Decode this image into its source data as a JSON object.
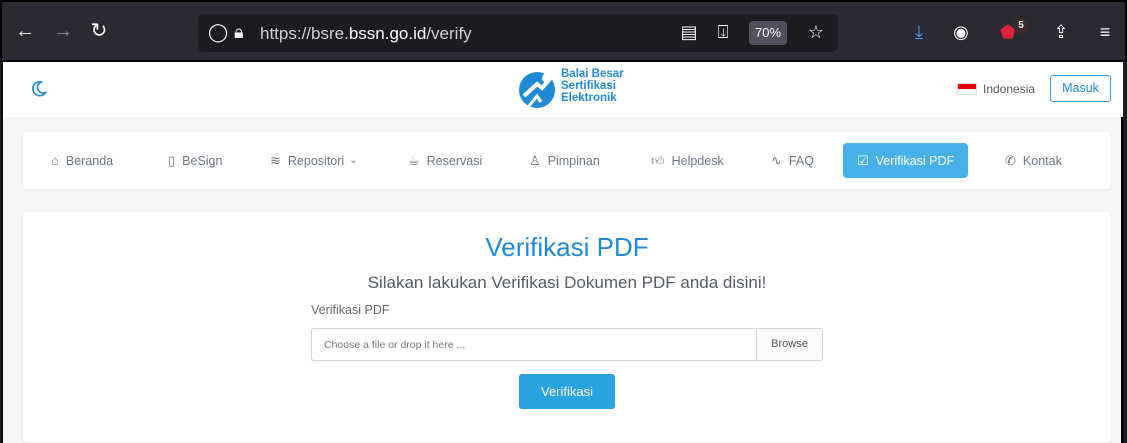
{
  "browser": {
    "url_prefix": "https://bsre.",
    "url_domain": "bssn.go.id",
    "url_path": "/verify",
    "zoom": "70%",
    "extension_badge": "5"
  },
  "header": {
    "logo_line1": "Balai Besar",
    "logo_line2": "Sertifikasi",
    "logo_line3": "Elektronik",
    "language": "Indonesia",
    "login_label": "Masuk"
  },
  "nav": {
    "items": [
      {
        "label": "Beranda",
        "icon": "home-icon"
      },
      {
        "label": "BeSign",
        "icon": "phone-icon"
      },
      {
        "label": "Repositori",
        "icon": "layers-icon"
      },
      {
        "label": "Reservasi",
        "icon": "cup-icon"
      },
      {
        "label": "Pimpinan",
        "icon": "user-icon"
      },
      {
        "label": "Helpdesk",
        "icon": "thumbs-up-icon"
      },
      {
        "label": "FAQ",
        "icon": "activity-icon"
      },
      {
        "label": "Verifikasi PDF",
        "icon": "check-square-icon"
      },
      {
        "label": "Kontak",
        "icon": "phone-call-icon"
      }
    ]
  },
  "main": {
    "title": "Verifikasi PDF",
    "subtitle": "Silakan lakukan Verifikasi Dokumen PDF anda disini!",
    "field_label": "Verifikasi PDF",
    "file_placeholder": "Choose a file or drop it here ...",
    "browse_label": "Browse",
    "submit_label": "Verifikasi"
  },
  "colors": {
    "accent": "#2aa3e2",
    "nav_active": "#48b0e9",
    "title": "#1f8bd6"
  }
}
